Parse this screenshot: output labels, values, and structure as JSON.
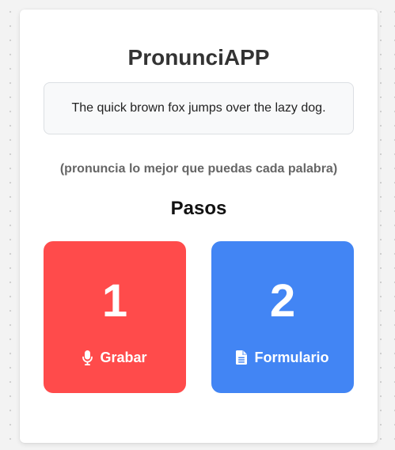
{
  "app": {
    "title": "PronunciAPP"
  },
  "sentence": {
    "text": "The quick brown fox jumps over the lazy dog."
  },
  "hint": {
    "text": "(pronuncia lo mejor que puedas cada palabra)"
  },
  "steps": {
    "heading": "Pasos",
    "items": [
      {
        "number": "1",
        "label": "Grabar",
        "icon": "microphone-icon",
        "color": "#ff4b4b"
      },
      {
        "number": "2",
        "label": "Formulario",
        "icon": "document-icon",
        "color": "#4285f4"
      }
    ]
  }
}
